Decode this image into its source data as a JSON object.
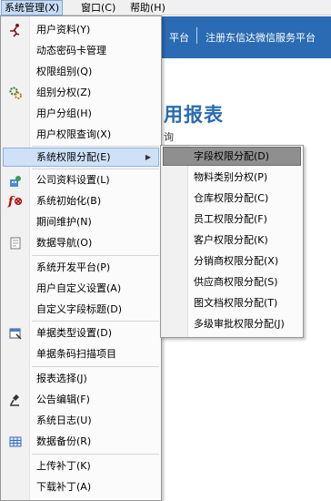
{
  "menubar": {
    "items": [
      {
        "label": "系统管理(X)"
      },
      {
        "label": "窗口(C)"
      },
      {
        "label": "帮助(H)"
      }
    ]
  },
  "background": {
    "header_left": "平台",
    "header_right": "注册东信达微信服务平台",
    "title": "用报表",
    "subtitle": "询"
  },
  "system_menu": {
    "items": [
      {
        "label": "用户资料(Y)",
        "icon": "user-run-icon"
      },
      {
        "label": "动态密码卡管理"
      },
      {
        "label": "权限组别(Q)"
      },
      {
        "label": "组别分权(Z)",
        "icon": "gears-icon"
      },
      {
        "label": "用户分组(H)"
      },
      {
        "label": "用户权限查询(X)"
      },
      {
        "label": "系统权限分配(E)",
        "highlighted": true,
        "has_submenu": true
      },
      {
        "label": "公司资料设置(L)",
        "icon": "company-icon"
      },
      {
        "label": "系统初始化(B)",
        "icon": "function-icon"
      },
      {
        "label": "期间维护(N)"
      },
      {
        "label": "数据导航(O)",
        "icon": "document-icon"
      },
      {
        "label": "系统开发平台(P)"
      },
      {
        "label": "用户自定义设置(A)"
      },
      {
        "label": "自定义字段标题(D)"
      },
      {
        "label": "单据类型设置(D)",
        "icon": "window-icon"
      },
      {
        "label": "单据条码扫描项目"
      },
      {
        "label": "报表选择(J)"
      },
      {
        "label": "公告编辑(F)",
        "icon": "microscope-icon"
      },
      {
        "label": "系统日志(U)"
      },
      {
        "label": "数据备份(R)",
        "icon": "grid-icon"
      },
      {
        "label": "上传补丁(K)"
      },
      {
        "label": "下载补丁(A)"
      }
    ]
  },
  "submenu": {
    "items": [
      {
        "label": "字段权限分配(D)",
        "highlighted": true
      },
      {
        "label": "物料类别分权(P)"
      },
      {
        "label": "仓库权限分配(C)"
      },
      {
        "label": "员工权限分配(F)"
      },
      {
        "label": "客户权限分配(K)"
      },
      {
        "label": "分销商权限分配(X)"
      },
      {
        "label": "供应商权限分配(S)"
      },
      {
        "label": "图文档权限分配(T)"
      },
      {
        "label": "多级审批权限分配(J)"
      }
    ]
  },
  "colors": {
    "highlight": "#cfe1f7",
    "submenu_highlight": "#8f8f8f",
    "brand_blue": "#2a6bb3"
  }
}
